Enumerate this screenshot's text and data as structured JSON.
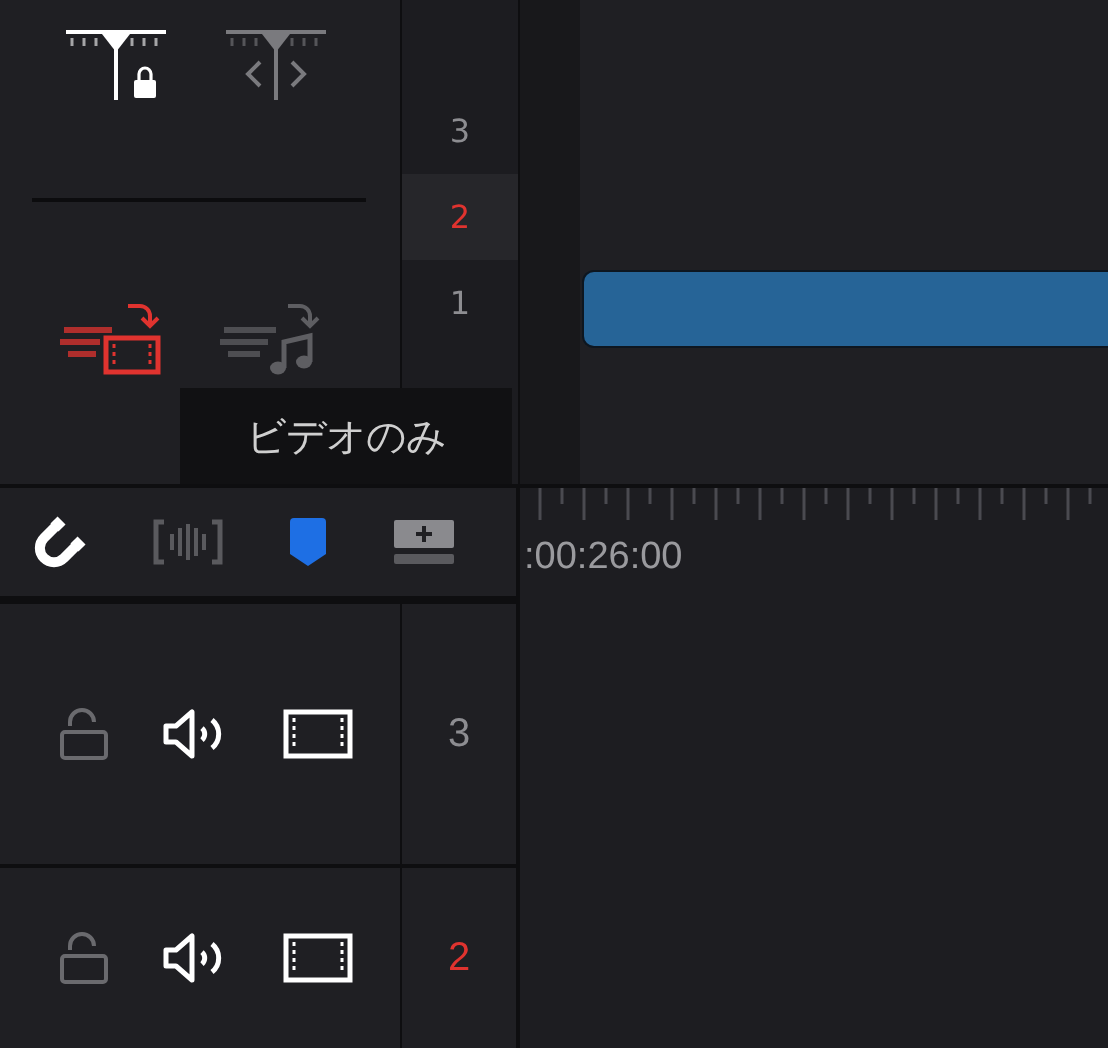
{
  "top_tools": [
    {
      "kind": "position-lock",
      "on": true
    },
    {
      "kind": "trim",
      "on": false
    }
  ],
  "destination_tools": [
    {
      "kind": "video",
      "on": true
    },
    {
      "kind": "audio",
      "on": false
    }
  ],
  "track_index": [
    {
      "label": "3",
      "selected": false
    },
    {
      "label": "2",
      "selected": true
    },
    {
      "label": "1",
      "selected": false
    }
  ],
  "tooltip": "ビデオのみ",
  "toolbar": [
    {
      "kind": "snap",
      "on": true
    },
    {
      "kind": "audio-scrub",
      "on": false
    },
    {
      "kind": "marker"
    },
    {
      "kind": "add-track"
    }
  ],
  "ruler": {
    "timecode": ":00:26:00"
  },
  "tracks": [
    {
      "label": "3",
      "selected": false,
      "locked": false
    },
    {
      "label": "2",
      "selected": true,
      "locked": false
    }
  ]
}
